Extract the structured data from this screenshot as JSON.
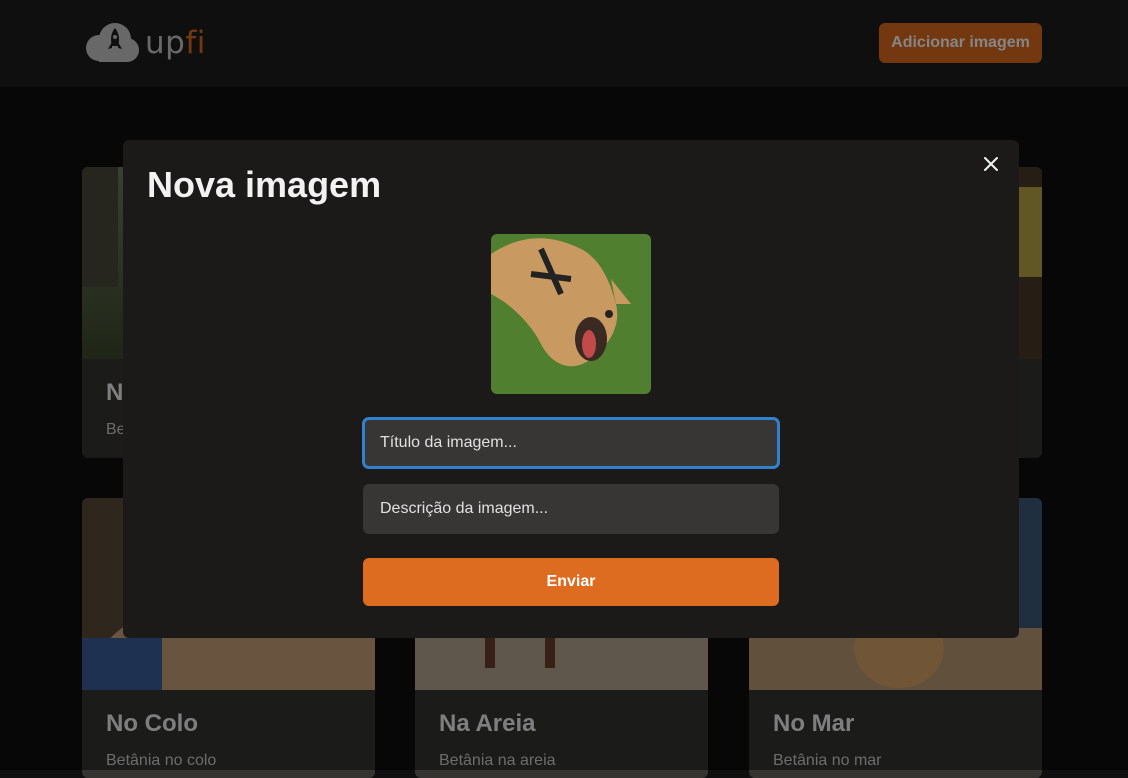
{
  "header": {
    "logo_prefix": "up",
    "logo_suffix": "fi",
    "add_button_label": "Adicionar imagem"
  },
  "cards": [
    {
      "title": "No Colo",
      "description": "Betânia no colo"
    },
    {
      "title": "Na Areia",
      "description": "Betânia na areia"
    },
    {
      "title": "No Mar",
      "description": "Betânia no mar"
    }
  ],
  "cards_partial": {
    "first_row_title_fragment": "N",
    "first_row_desc_fragment": "Be"
  },
  "modal": {
    "title": "Nova imagem",
    "title_placeholder": "Título da imagem...",
    "description_placeholder": "Descrição da imagem...",
    "submit_label": "Enviar"
  },
  "colors": {
    "accent": "#dd6b20",
    "focus": "#3182ce",
    "background": "#0f0f0f",
    "surface": "#1f1e1d"
  }
}
